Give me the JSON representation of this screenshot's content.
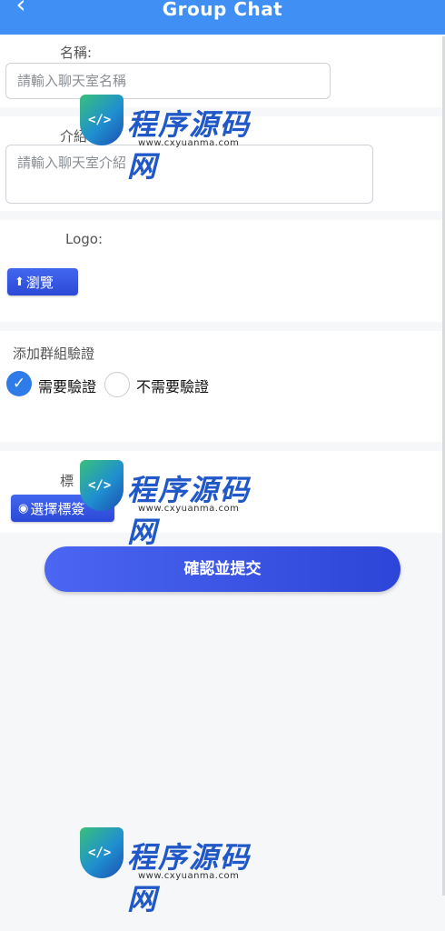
{
  "header": {
    "back_icon": "‹",
    "title": "Group Chat"
  },
  "form": {
    "name_label": "名稱:",
    "name_placeholder": "請輸入聊天室名稱",
    "intro_label": "介紹",
    "intro_placeholder": "請輸入聊天室介紹",
    "logo_label": "Logo:",
    "browse_button": "瀏覽",
    "verify_label": "添加群組驗證",
    "verify_options": [
      {
        "label": "需要驗證",
        "selected": true
      },
      {
        "label": "不需要驗證",
        "selected": false
      }
    ],
    "tags_label": "標",
    "choose_tags_button": "選擇標簽",
    "submit_button": "確認並提交"
  },
  "watermark": {
    "brand": "程序源码网",
    "url": "www.cxyuanma.com",
    "code_glyph": "</>"
  },
  "colors": {
    "header": "#3f8ff5",
    "primary": "#2d45d8",
    "radio_selected": "#2f7be8"
  }
}
